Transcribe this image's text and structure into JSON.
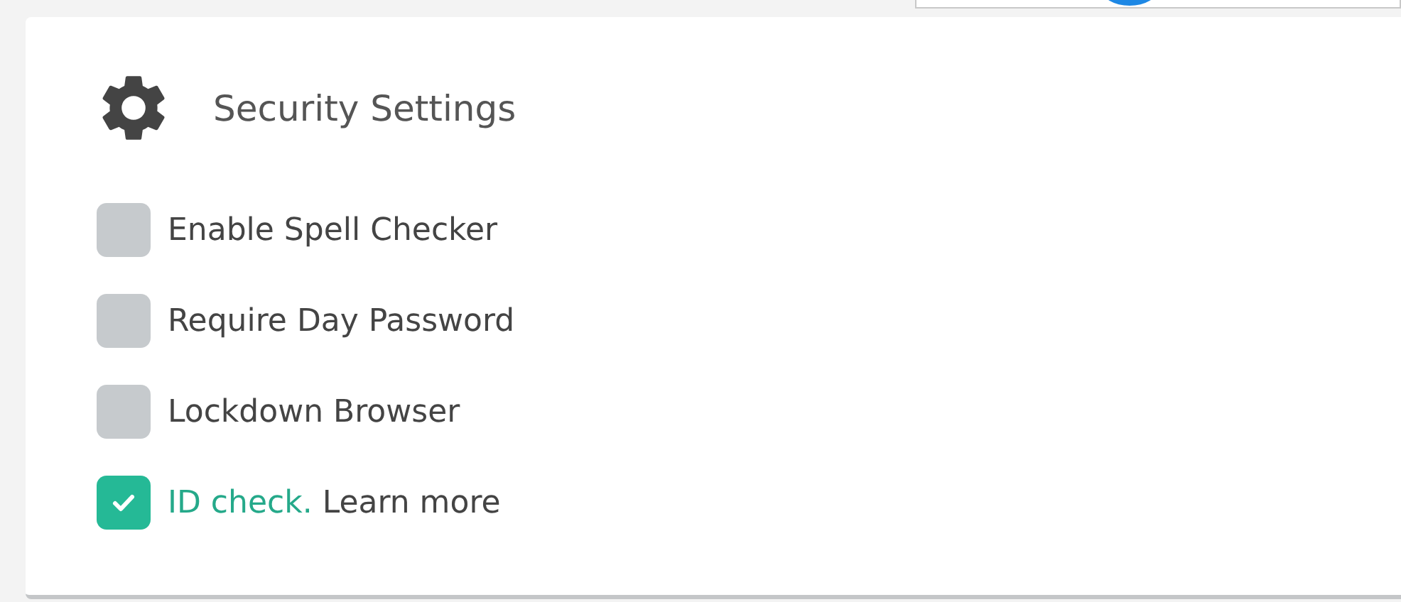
{
  "panel": {
    "title": "Security Settings"
  },
  "options": [
    {
      "label": "Enable Spell Checker",
      "checked": false
    },
    {
      "label": "Require Day Password",
      "checked": false
    },
    {
      "label": "Lockdown Browser",
      "checked": false
    },
    {
      "label": "ID check.",
      "link": "Learn more",
      "checked": true
    }
  ]
}
